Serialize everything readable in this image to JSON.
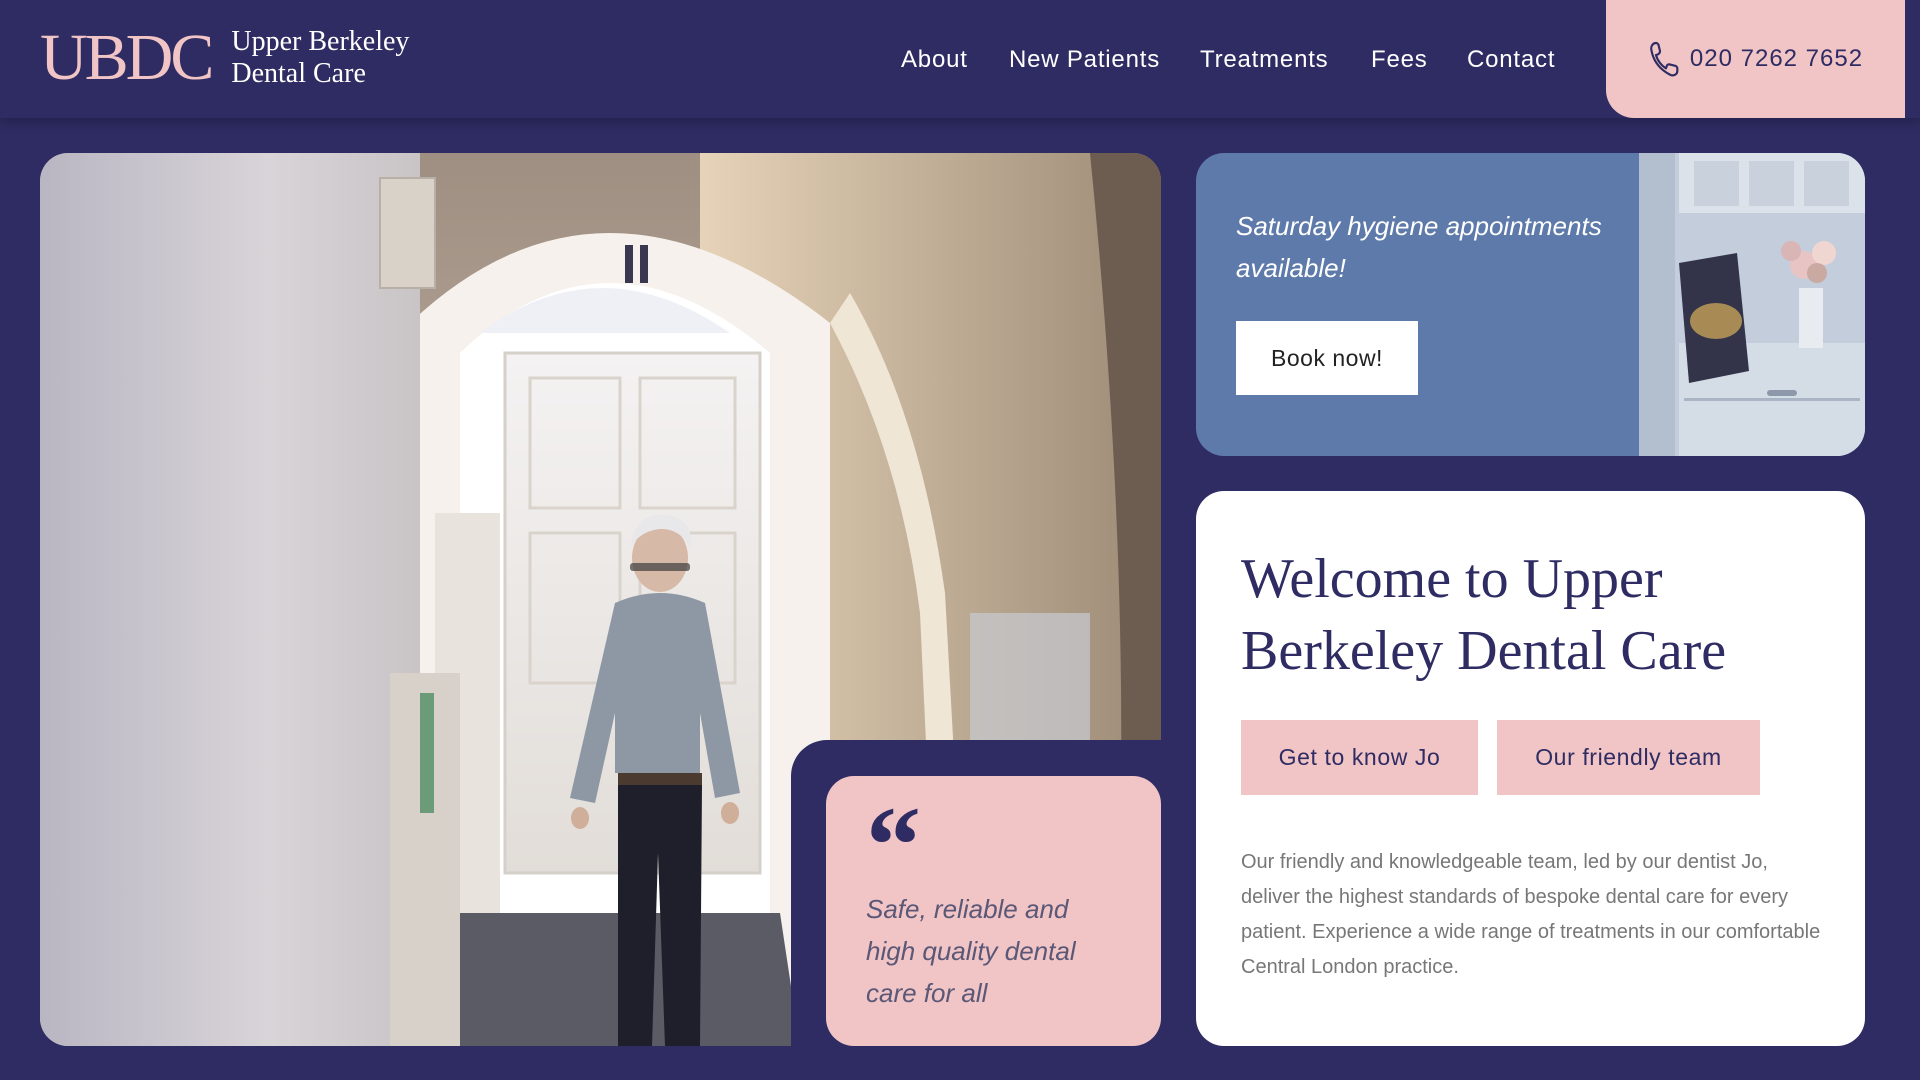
{
  "header": {
    "logo_mark": "UBDC",
    "logo_line1": "Upper Berkeley",
    "logo_line2": "Dental Care",
    "nav": [
      "About",
      "New Patients",
      "Treatments",
      "Fees",
      "Contact"
    ],
    "phone": "020 7262 7652",
    "phone_icon": "phone-icon"
  },
  "quote": {
    "mark": "“",
    "text": "Safe, reliable and high quality dental care for all"
  },
  "promo": {
    "text": "Saturday hygiene appointments available!",
    "button": "Book now!"
  },
  "welcome": {
    "title": "Welcome to Upper Berkeley Dental Care",
    "buttons": [
      "Get to know Jo",
      "Our friendly team"
    ],
    "body": "Our friendly and knowledgeable team, led by our dentist Jo, deliver the highest standards of bespoke dental care for every patient. Experience a wide range of treatments in our comfortable Central London practice."
  },
  "colors": {
    "navy": "#2e2c63",
    "pink": "#f1c4c6",
    "blue": "#5e7aaa",
    "white": "#ffffff"
  }
}
